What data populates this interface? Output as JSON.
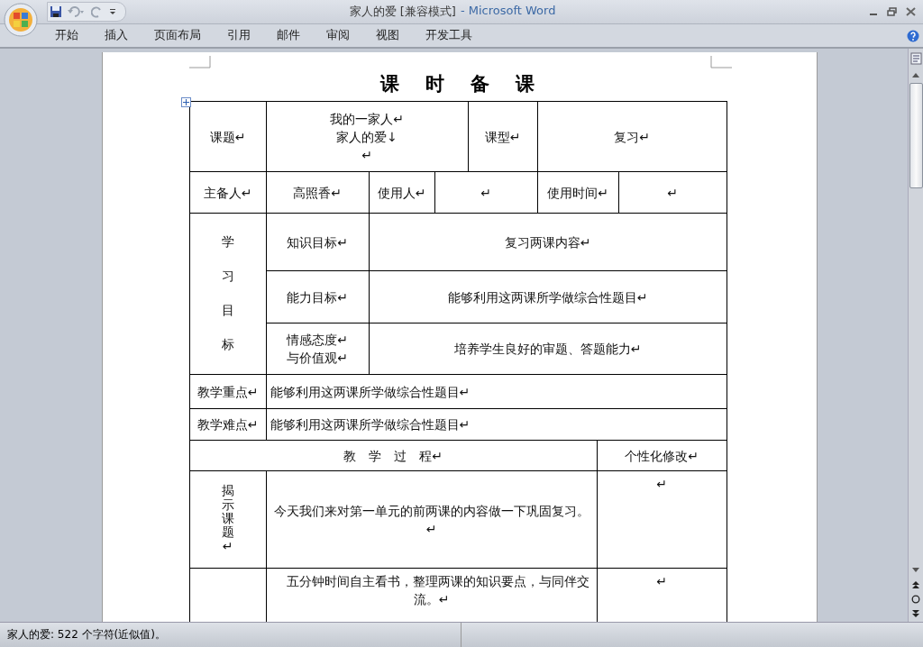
{
  "window": {
    "title": "家人的爱 [兼容模式]",
    "app_name": "- Microsoft Word"
  },
  "ribbon": {
    "tabs": [
      {
        "label": "开始",
        "selected": false
      },
      {
        "label": "插入",
        "selected": false
      },
      {
        "label": "页面布局",
        "selected": false
      },
      {
        "label": "引用",
        "selected": false
      },
      {
        "label": "邮件",
        "selected": false
      },
      {
        "label": "审阅",
        "selected": false
      },
      {
        "label": "视图",
        "selected": false
      },
      {
        "label": "开发工具",
        "selected": false
      }
    ]
  },
  "document": {
    "heading": "课　时　备　课",
    "table": {
      "rows": [
        [
          {
            "text": "课题↵"
          },
          {
            "text": "我的一家人↵\n家人的爱↓\n↵",
            "colspan": 3
          },
          {
            "text": "课型↵"
          },
          {
            "text": "复习↵",
            "colspan": 3
          }
        ],
        [
          {
            "text": "主备人↵"
          },
          {
            "text": "高照香↵"
          },
          {
            "text": "使用人↵"
          },
          {
            "text": "↵",
            "colspan": 2
          },
          {
            "text": "使用时间↵",
            "colspan": 2
          },
          {
            "text": "↵"
          }
        ],
        [
          {
            "text": "学习目标",
            "kind": "vertical",
            "rowspan": 3
          },
          {
            "text": "知识目标↵"
          },
          {
            "text": "复习两课内容↵",
            "colspan": 6
          }
        ],
        [
          {
            "text": "能力目标↵"
          },
          {
            "text": "能够利用这两课所学做综合性题目↵",
            "colspan": 6
          }
        ],
        [
          {
            "text": "情感态度↵\n与价值观↵"
          },
          {
            "text": "培养学生良好的审题、答题能力↵",
            "colspan": 6
          }
        ],
        [
          {
            "text": "教学重点↵"
          },
          {
            "text": "能够利用这两课所学做综合性题目↵",
            "colspan": 7
          }
        ],
        [
          {
            "text": "教学难点↵"
          },
          {
            "text": "能够利用这两课所学做综合性题目↵",
            "colspan": 7
          }
        ],
        [
          {
            "text": "教　学　过　程↵",
            "colspan": 6
          },
          {
            "text": "个性化修改↵",
            "colspan": 2
          }
        ],
        [
          {
            "text": "揭示课题↵",
            "kind": "vertical"
          },
          {
            "text": "今天我们来对第一单元的前两课的内容做一下巩固复习。↵",
            "colspan": 5
          },
          {
            "text": "↵",
            "colspan": 2
          }
        ],
        [
          {
            "text": ""
          },
          {
            "text": "　五分钟时间自主看书，整理两课的知识要点，与同伴交流。↵",
            "colspan": 5
          },
          {
            "text": "↵",
            "colspan": 2
          }
        ]
      ]
    }
  },
  "status_bar": {
    "text": "家人的爱: 522 个字符(近似值)。"
  }
}
